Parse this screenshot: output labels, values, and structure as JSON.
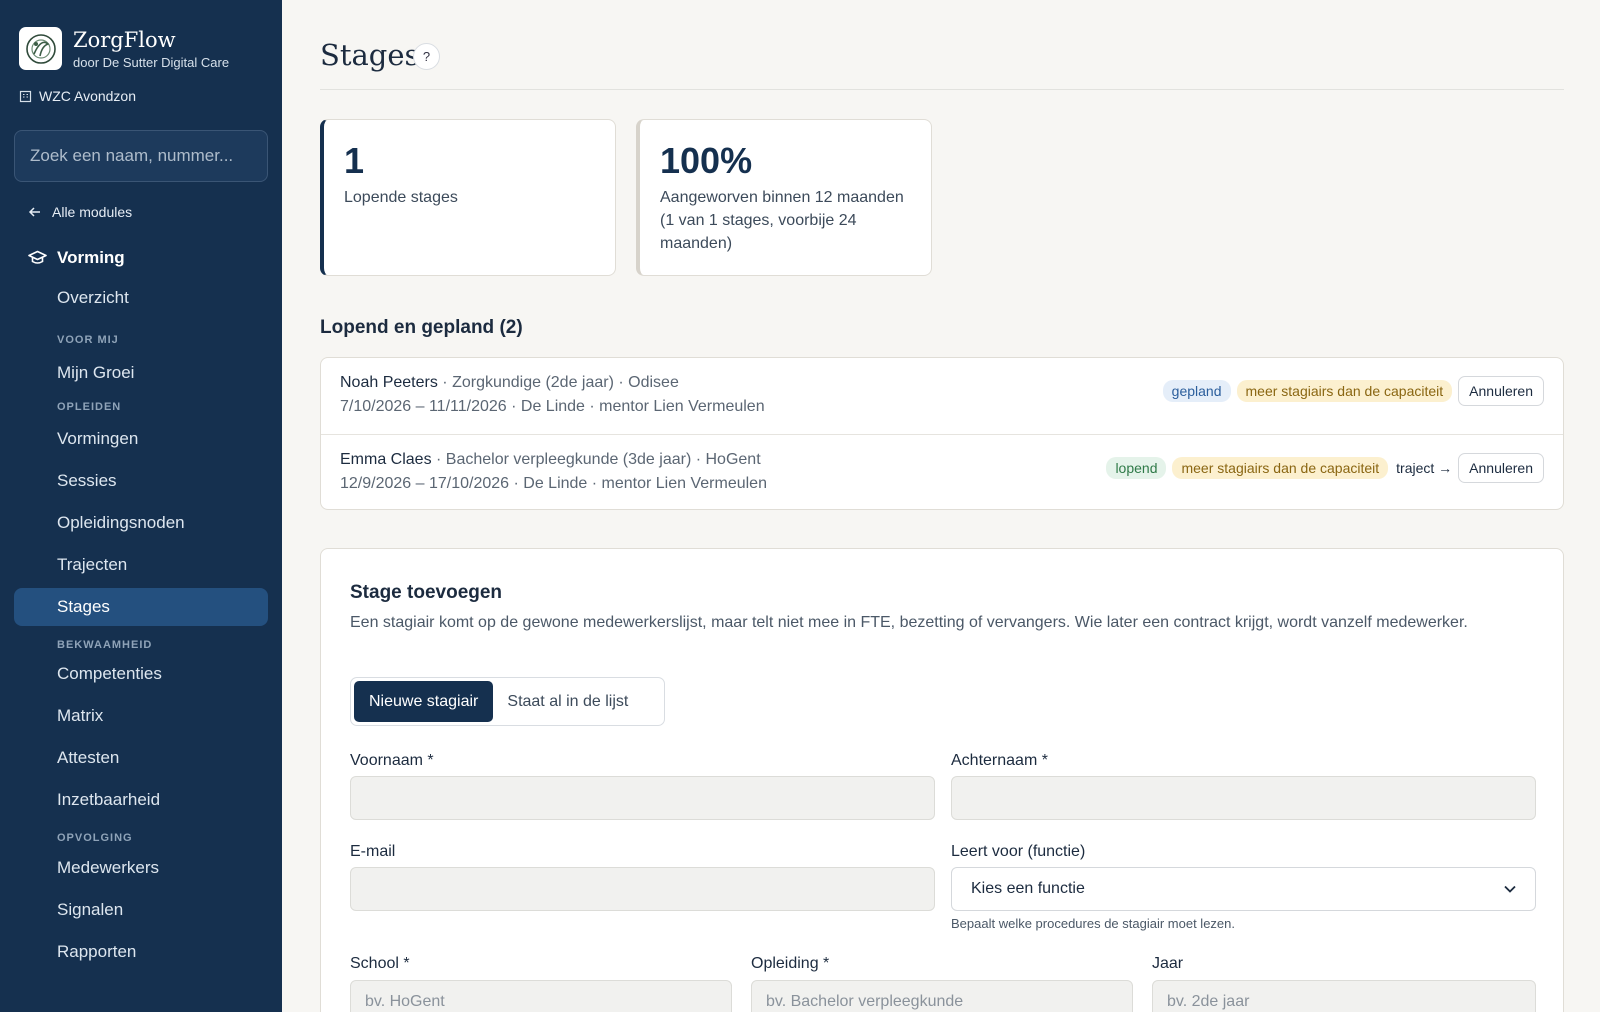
{
  "brand": {
    "name": "ZorgFlow",
    "sub": "door De Sutter Digital Care"
  },
  "site": "WZC Avondzon",
  "search": {
    "placeholder": "Zoek een naam, nummer..."
  },
  "back_label": "Alle modules",
  "module": "Vorming",
  "nav": {
    "overzicht": "Overzicht",
    "section_mij": "VOOR MIJ",
    "mijn_groei": "Mijn Groei",
    "section_opleiden": "OPLEIDEN",
    "vormingen": "Vormingen",
    "sessies": "Sessies",
    "opleidingsnoden": "Opleidingsnoden",
    "trajecten": "Trajecten",
    "stages": "Stages",
    "section_bekwaamheid": "BEKWAAMHEID",
    "competenties": "Competenties",
    "matrix": "Matrix",
    "attesten": "Attesten",
    "inzetbaarheid": "Inzetbaarheid",
    "section_opvolging": "OPVOLGING",
    "medewerkers": "Medewerkers",
    "signalen": "Signalen",
    "rapporten": "Rapporten"
  },
  "page": {
    "title": "Stages",
    "help": "?"
  },
  "stats": [
    {
      "value": "1",
      "label": "Lopende stages"
    },
    {
      "value": "100%",
      "label": "Aangeworven binnen 12 maanden (1 van 1 stages, voorbije 24 maanden)"
    }
  ],
  "list": {
    "heading": "Lopend en gepland (2)",
    "rows": [
      {
        "name": "Noah Peeters",
        "detail": " · Zorgkundige (2de jaar) · Odisee",
        "period": "7/10/2026 – 11/11/2026 · De Linde · mentor Lien Vermeulen",
        "status": "gepland",
        "warning": "meer stagiairs dan de capaciteit",
        "action": "Annuleren"
      },
      {
        "name": "Emma Claes",
        "detail": " · Bachelor verpleegkunde (3de jaar) · HoGent",
        "period": "12/9/2026 – 17/10/2026 · De Linde · mentor Lien Vermeulen",
        "status": "lopend",
        "warning": "meer stagiairs dan de capaciteit",
        "link": "traject →",
        "action": "Annuleren"
      }
    ]
  },
  "form": {
    "title": "Stage toevoegen",
    "desc": "Een stagiair komt op de gewone medewerkerslijst, maar telt niet mee in FTE, bezetting of vervangers. Wie later een contract krijgt, wordt vanzelf medewerker.",
    "seg_on": "Nieuwe stagiair",
    "seg_off": "Staat al in de lijst",
    "voornaam": "Voornaam *",
    "achternaam": "Achternaam *",
    "email": "E-mail",
    "functie": "Leert voor (functie)",
    "functie_value": "Kies een functie",
    "functie_hint": "Bepaalt welke procedures de stagiair moet lezen.",
    "school": "School *",
    "school_ph": "bv. HoGent",
    "opleiding": "Opleiding *",
    "opleiding_ph": "bv. Bachelor verpleegkunde",
    "jaar": "Jaar",
    "jaar_ph": "bv. 2de jaar"
  }
}
